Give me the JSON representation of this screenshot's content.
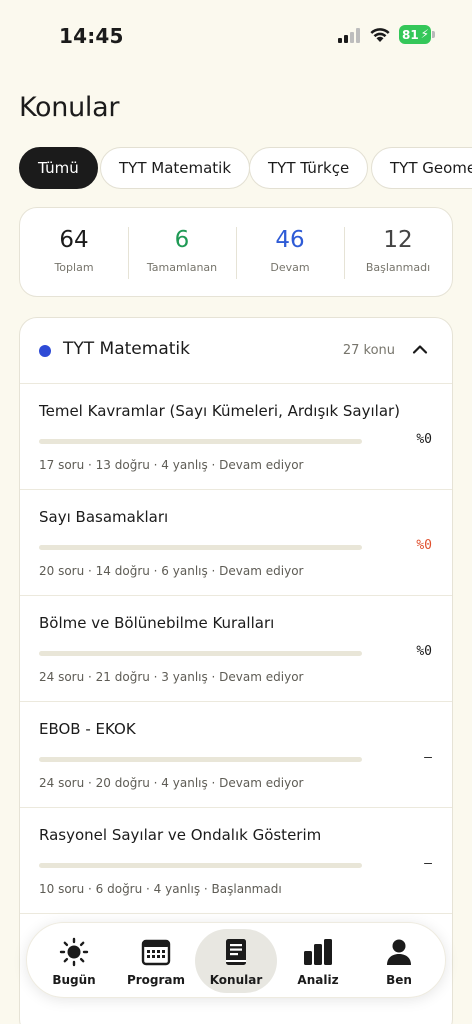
{
  "status_bar": {
    "time": "14:45",
    "battery": "81"
  },
  "page": {
    "title": "Konular"
  },
  "filters": [
    {
      "label": "Tümü",
      "active": true
    },
    {
      "label": "TYT Matematik",
      "active": false
    },
    {
      "label": "TYT Türkçe",
      "active": false
    },
    {
      "label": "TYT Geometri",
      "active": false
    }
  ],
  "stats": [
    {
      "value": "64",
      "label": "Toplam",
      "color": "#1B1B1B"
    },
    {
      "value": "6",
      "label": "Tamamlanan",
      "color": "#1F9A55"
    },
    {
      "value": "46",
      "label": "Devam",
      "color": "#2E5BD6"
    },
    {
      "value": "12",
      "label": "Başlanmadı",
      "color": "#444444"
    }
  ],
  "section": {
    "title": "TYT Matematik",
    "dot_color": "#2E4BD6",
    "count": "27 konu",
    "topics": [
      {
        "title": "Temel Kavramlar (Sayı Kümeleri, Ardışık Sayılar)",
        "progress_percent": 0,
        "pct_text": "%0",
        "pct_color": "#1B1B1B",
        "meta": "17 soru · 13 doğru · 4 yanlış · Devam ediyor"
      },
      {
        "title": "Sayı Basamakları",
        "progress_percent": 0,
        "pct_text": "%0",
        "pct_color": "#E0502E",
        "meta": "20 soru · 14 doğru · 6 yanlış · Devam ediyor"
      },
      {
        "title": "Bölme ve Bölünebilme Kuralları",
        "progress_percent": 0,
        "pct_text": "%0",
        "pct_color": "#1B1B1B",
        "meta": "24 soru · 21 doğru · 3 yanlış · Devam ediyor"
      },
      {
        "title": "EBOB - EKOK",
        "progress_percent": 0,
        "pct_text": "–",
        "pct_color": "#1B1B1B",
        "meta": "24 soru · 20 doğru · 4 yanlış · Devam ediyor"
      },
      {
        "title": "Rasyonel Sayılar ve Ondalık Gösterim",
        "progress_percent": 0,
        "pct_text": "–",
        "pct_color": "#1B1B1B",
        "meta": "10 soru · 6 doğru · 4 yanlış · Başlanmadı"
      }
    ]
  },
  "nav": [
    {
      "label": "Bugün",
      "icon": "sun-icon",
      "active": false
    },
    {
      "label": "Program",
      "icon": "calendar-icon",
      "active": false
    },
    {
      "label": "Konular",
      "icon": "book-icon",
      "active": true
    },
    {
      "label": "Analiz",
      "icon": "bar-chart-icon",
      "active": false
    },
    {
      "label": "Ben",
      "icon": "person-icon",
      "active": false
    }
  ]
}
